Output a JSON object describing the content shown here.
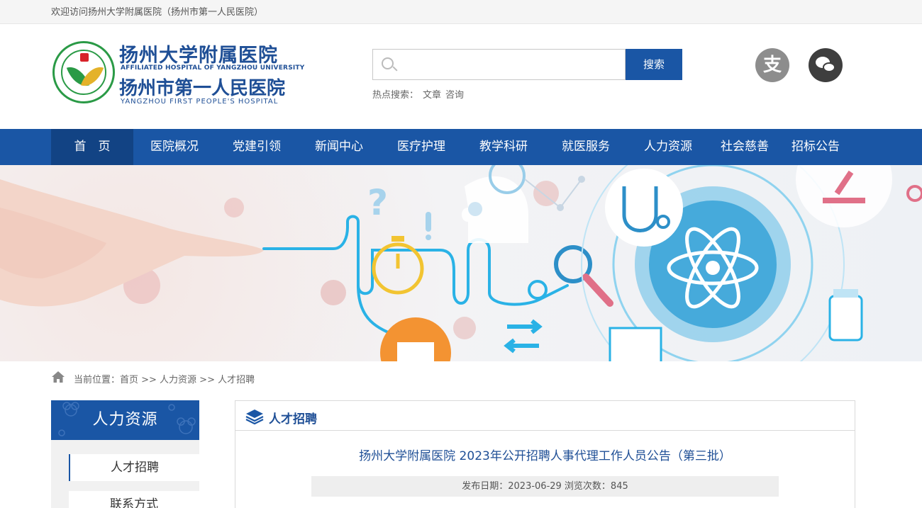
{
  "topbar": {
    "welcome": "欢迎访问扬州大学附属医院（扬州市第一人民医院）"
  },
  "logo": {
    "name_cn": "扬州大学附属医院",
    "name_en": "AFFILIATED HOSPITAL OF YANGZHOU UNIVERSITY",
    "alt_name_cn": "扬州市第一人民医院",
    "alt_name_en": "YANGZHOU FIRST PEOPLE'S HOSPITAL"
  },
  "search": {
    "placeholder": "",
    "value": "",
    "button_label": "搜索",
    "hot_label": "热点搜索：",
    "hot_words": [
      "文章",
      "咨询"
    ]
  },
  "social": {
    "alipay_glyph": "支",
    "icons": [
      "alipay-icon",
      "wechat-icon"
    ]
  },
  "nav": {
    "items": [
      "首　页",
      "医院概况",
      "党建引领",
      "新闻中心",
      "医疗护理",
      "教学科研",
      "就医服务",
      "人力资源",
      "社会慈善",
      "招标公告"
    ],
    "active_index": 0
  },
  "breadcrumb": {
    "text": "当前位置：首页 >> 人力资源 >> 人才招聘"
  },
  "sidebar": {
    "title": "人力资源",
    "items": [
      "人才招聘",
      "联系方式"
    ],
    "active_index": 0
  },
  "content": {
    "section_title": "人才招聘",
    "article_title": "扬州大学附属医院 2023年公开招聘人事代理工作人员公告（第三批）",
    "meta": "发布日期：2023-06-29 浏览次数：845"
  },
  "colors": {
    "primary": "#1a56a5",
    "nav_active": "#124384",
    "logo_green": "#2a9a46",
    "logo_blue": "#1f4f96"
  }
}
